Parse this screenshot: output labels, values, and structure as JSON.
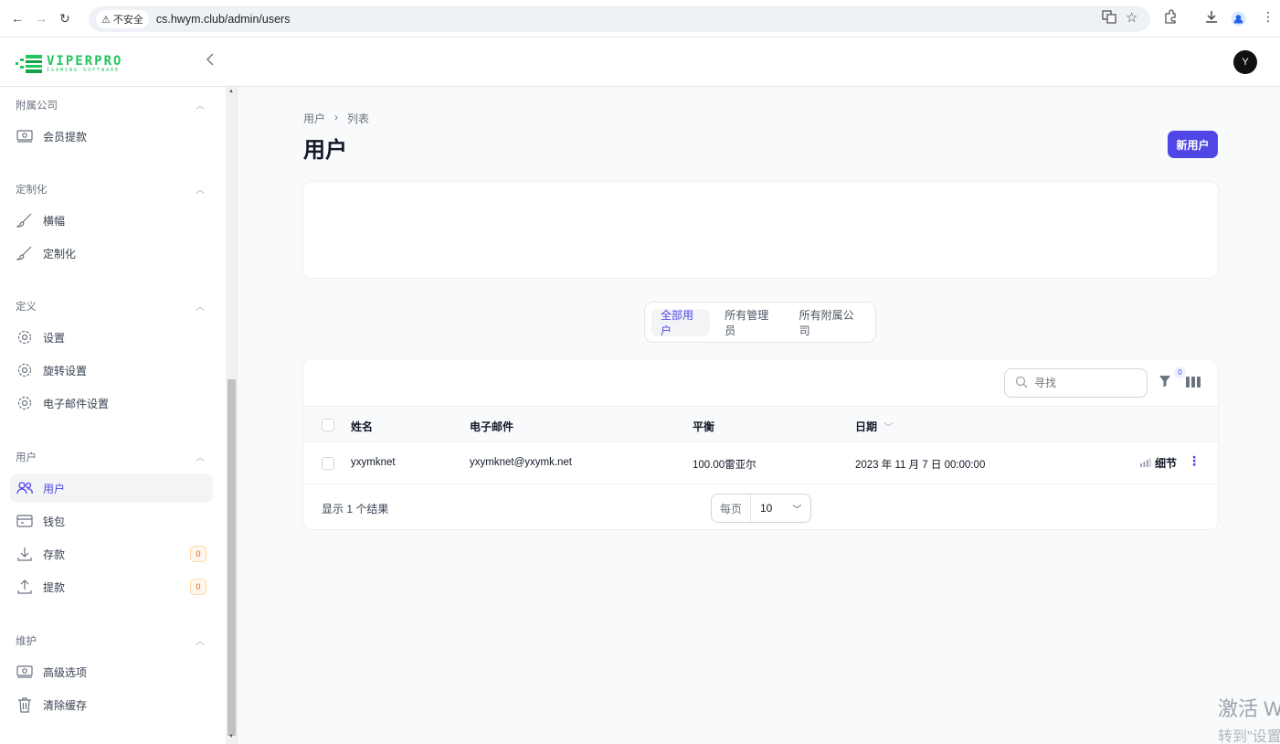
{
  "browser": {
    "insecure_label": "不安全",
    "url": "cs.hwym.club/admin/users"
  },
  "brand": {
    "name": "VIPERPRO",
    "tagline": "IGAMING SOFTWARE",
    "accent": "#22c55e"
  },
  "user": {
    "avatar_initial": "Y"
  },
  "sidebar": {
    "groups": [
      {
        "title": "附属公司",
        "items": [
          {
            "label": "会员提款",
            "icon": "cash-icon"
          }
        ]
      },
      {
        "title": "定制化",
        "items": [
          {
            "label": "横幅",
            "icon": "brush-icon"
          },
          {
            "label": "定制化",
            "icon": "brush-icon"
          }
        ]
      },
      {
        "title": "定义",
        "items": [
          {
            "label": "设置",
            "icon": "gear-icon"
          },
          {
            "label": "旋转设置",
            "icon": "gear-icon"
          },
          {
            "label": "电子邮件设置",
            "icon": "gear-icon"
          }
        ]
      },
      {
        "title": "用户",
        "items": [
          {
            "label": "用户",
            "icon": "users-icon",
            "active": true
          },
          {
            "label": "钱包",
            "icon": "wallet-icon"
          },
          {
            "label": "存款",
            "icon": "download-icon",
            "badge": "0"
          },
          {
            "label": "提款",
            "icon": "upload-icon",
            "badge": "0"
          }
        ]
      },
      {
        "title": "维护",
        "items": [
          {
            "label": "高级选项",
            "icon": "cash-icon"
          },
          {
            "label": "清除缓存",
            "icon": "trash-icon"
          }
        ]
      }
    ]
  },
  "page": {
    "breadcrumb": [
      "用户",
      "列表"
    ],
    "title": "用户",
    "new_button": "新用户",
    "accent": "#4f46e5"
  },
  "tabs": [
    {
      "label": "全部用户",
      "active": true
    },
    {
      "label": "所有管理员"
    },
    {
      "label": "所有附属公司"
    }
  ],
  "table": {
    "search_placeholder": "寻找",
    "filter_count": "0",
    "columns": [
      "姓名",
      "电子邮件",
      "平衡",
      "日期"
    ],
    "rows": [
      {
        "name": "yxymknet",
        "email": "yxymknet@yxymk.net",
        "balance": "100.00雷亚尔",
        "date": "2023 年 11 月 7 日 00:00:00",
        "action": "细节"
      }
    ],
    "results_text": "显示 1 个结果",
    "per_page_label": "每页",
    "per_page_value": "10"
  },
  "watermark": {
    "line1": "激活 W",
    "line2": "转到\"设置"
  }
}
